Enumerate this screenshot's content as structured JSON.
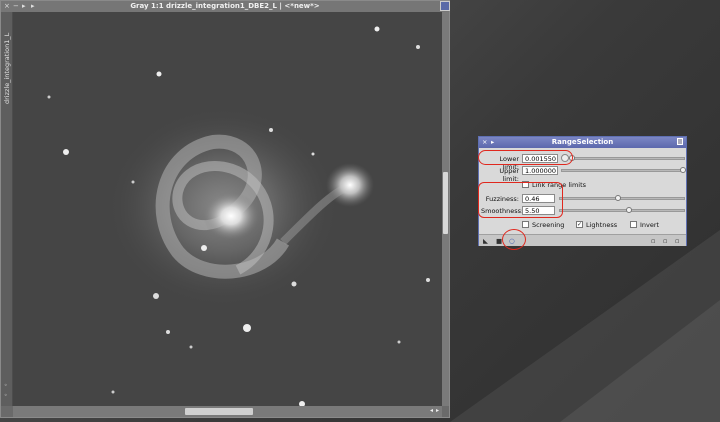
{
  "image_window": {
    "title": "Gray 1:1 drizzle_integration1_DBE2_L | <*new*>",
    "side_tab_label": "drizzle_integration1_L",
    "title_buttons": [
      "×",
      "−",
      "+",
      "+"
    ]
  },
  "range_selection": {
    "title": "RangeSelection",
    "lower_limit_label": "Lower limit:",
    "lower_limit_value": "0.001550",
    "upper_limit_label": "Upper limit:",
    "upper_limit_value": "1.000000",
    "link_range_label": "Link range limits",
    "fuzziness_label": "Fuzziness:",
    "fuzziness_value": "0.46",
    "smoothness_label": "Smoothness:",
    "smoothness_value": "5.50",
    "screening_label": "Screening",
    "lightness_label": "Lightness",
    "invert_label": "Invert",
    "screening_checked": false,
    "lightness_checked": true,
    "invert_checked": false,
    "link_range_checked": false,
    "sliders": {
      "lower": 0.0,
      "upper": 1.0,
      "fuzziness": 0.46,
      "smoothness": 0.55
    }
  },
  "colors": {
    "highlight": "#e0281e",
    "dialog_title": "#5c68ad"
  }
}
